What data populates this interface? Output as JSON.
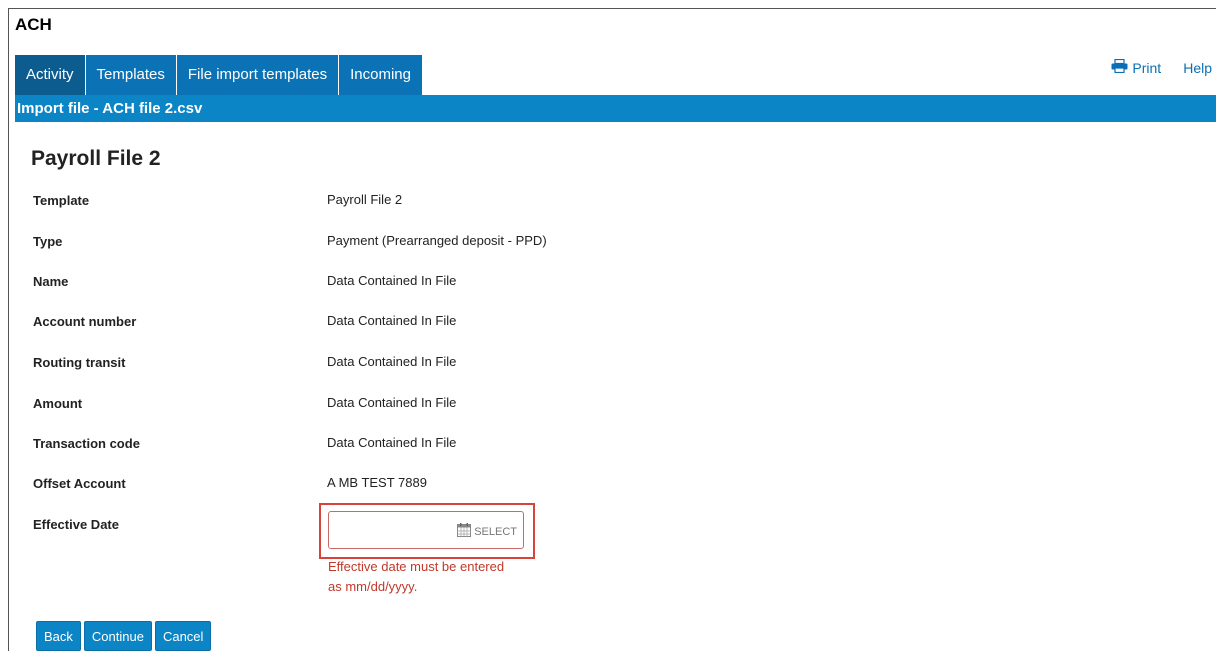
{
  "app": {
    "title": "ACH"
  },
  "tabs": [
    {
      "label": "Activity",
      "active": true
    },
    {
      "label": "Templates",
      "active": false
    },
    {
      "label": "File import templates",
      "active": false
    },
    {
      "label": "Incoming",
      "active": false
    }
  ],
  "top_links": {
    "print": "Print",
    "help": "Help"
  },
  "subheader": "Import file - ACH file 2.csv",
  "page_title": "Payroll File 2",
  "fields": [
    {
      "label": "Template",
      "value": "Payroll File 2"
    },
    {
      "label": "Type",
      "value": "Payment (Prearranged deposit - PPD)"
    },
    {
      "label": "Name",
      "value": "Data Contained In File"
    },
    {
      "label": "Account number",
      "value": "Data Contained In File"
    },
    {
      "label": "Routing transit",
      "value": "Data Contained In File"
    },
    {
      "label": "Amount",
      "value": "Data Contained In File"
    },
    {
      "label": "Transaction code",
      "value": "Data Contained In File"
    },
    {
      "label": "Offset Account",
      "value": "A MB TEST 7889"
    }
  ],
  "effective_date": {
    "label": "Effective Date",
    "value": "",
    "select_label": "SELECT",
    "error": "Effective date must be entered as mm/dd/yyyy."
  },
  "buttons": {
    "back": "Back",
    "continue": "Continue",
    "cancel": "Cancel"
  },
  "icons": {
    "print": "printer-icon",
    "calendar": "calendar-icon"
  },
  "colors": {
    "tab": "#0b72b5",
    "tab_active": "#0d5c8f",
    "subheader": "#0b85c6",
    "error": "#c0392b",
    "highlight": "#d9443a"
  }
}
